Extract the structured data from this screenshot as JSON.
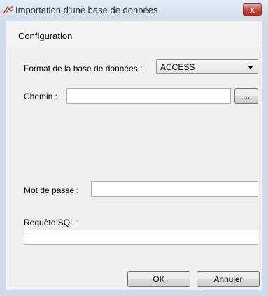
{
  "window": {
    "title": "Importation d'une base de données",
    "close_symbol": "x",
    "app_icon": "import-arrows-icon"
  },
  "header": {
    "title": "Configuration"
  },
  "form": {
    "format_label": "Format de la base de données :",
    "format_value": "ACCESS",
    "path_label": "Chemin :",
    "path_value": "",
    "browse_label": "...",
    "password_label": "Mot de passe :",
    "password_value": "",
    "sql_label": "Requête SQL :",
    "sql_value": ""
  },
  "buttons": {
    "ok": "OK",
    "cancel": "Annuler"
  },
  "colors": {
    "close_red": "#c8493a",
    "frame": "#cfdbe8",
    "panel": "#f0f0f0"
  }
}
